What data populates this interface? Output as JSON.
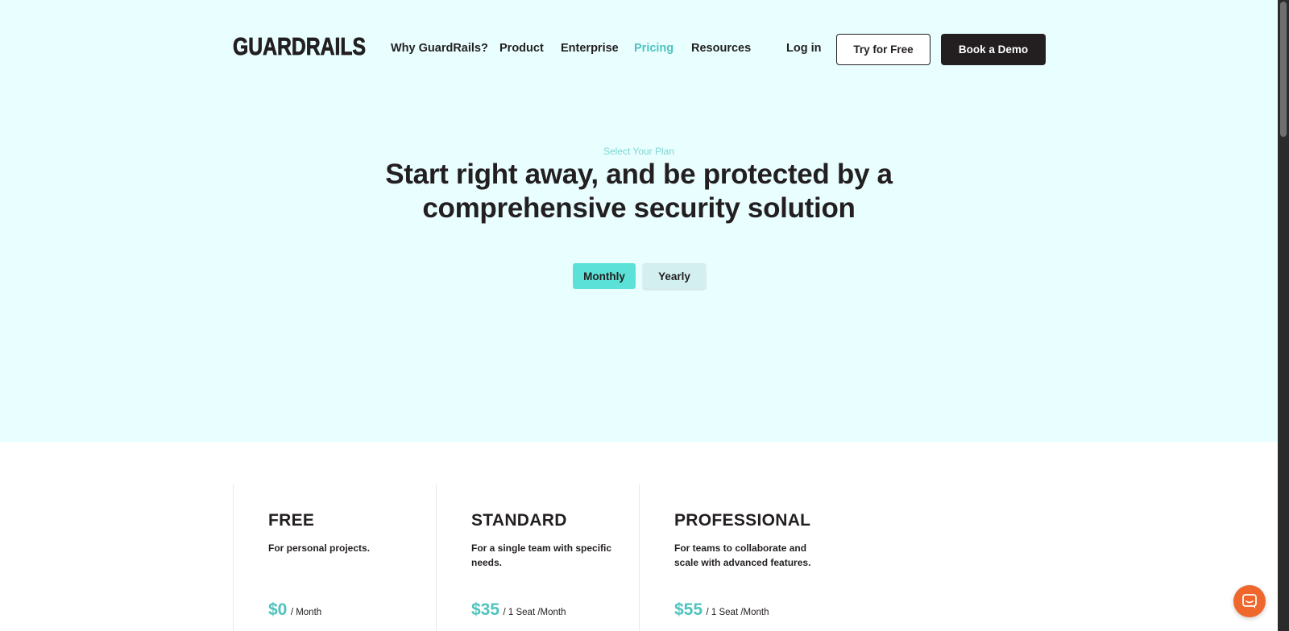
{
  "brand": {
    "logo_text": "GUARDRAILS"
  },
  "nav": {
    "links": [
      {
        "label": "Why GuardRails?"
      },
      {
        "label": "Product"
      },
      {
        "label": "Enterprise"
      },
      {
        "label": "Pricing",
        "active": true
      },
      {
        "label": "Resources"
      }
    ],
    "login_label": "Log in",
    "try_label": "Try for Free",
    "demo_label": "Book a Demo"
  },
  "hero": {
    "eyebrow": "Select Your Plan",
    "headline_line1": "Start right away, and be protected by a",
    "headline_line2": "comprehensive security solution",
    "billing_options": [
      {
        "label": "Monthly",
        "selected": true
      },
      {
        "label": "Yearly",
        "selected": false
      }
    ]
  },
  "plans": [
    {
      "name": "FREE",
      "description": "For personal projects.",
      "price": "$0",
      "unit": "/ Month"
    },
    {
      "name": "STANDARD",
      "description": "For a single team with specific needs.",
      "price": "$35",
      "unit": "/ 1 Seat /Month"
    },
    {
      "name": "PROFESSIONAL",
      "description": "For teams to collaborate and scale with advanced features.",
      "price": "$55",
      "unit": "/ 1 Seat /Month"
    }
  ],
  "icons": {
    "chat": "chat-bubble-icon"
  },
  "colors": {
    "accent": "#4fc3be",
    "hero_bg": "#e8feff",
    "dark": "#231f20",
    "toggle_active": "#5ce1d8",
    "chat_launcher": "#f0672e"
  }
}
